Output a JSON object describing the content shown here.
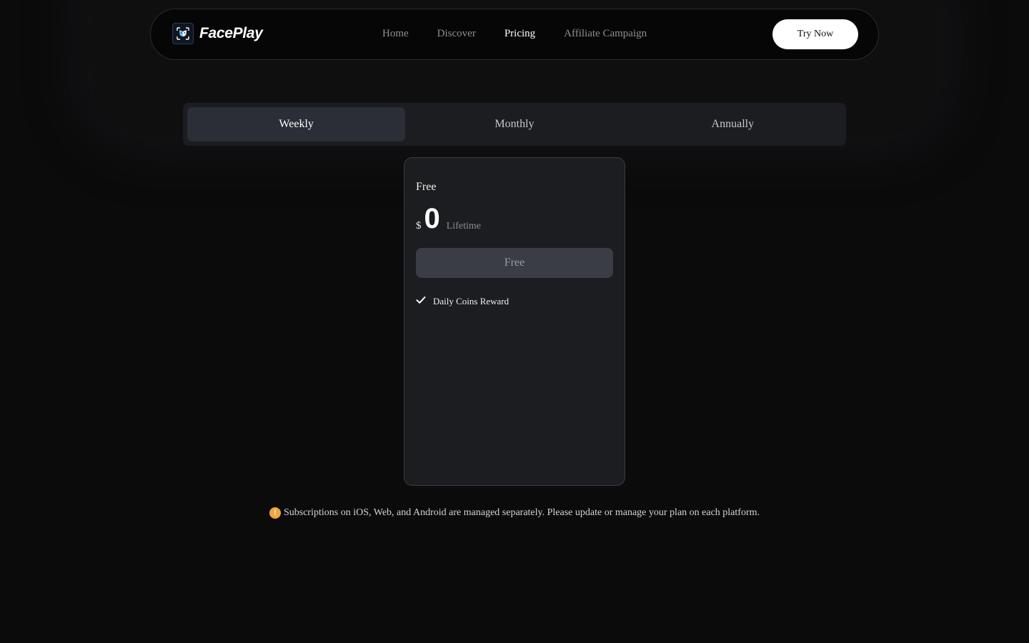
{
  "brand": {
    "name": "FacePlay",
    "logo_icon": "faceplay-logo-icon"
  },
  "nav": {
    "links": [
      "Home",
      "Discover",
      "Pricing",
      "Affiliate Campaign"
    ],
    "active": "Pricing",
    "cta_label": "Try Now"
  },
  "billing_tabs": {
    "items": [
      "Weekly",
      "Monthly",
      "Annually"
    ],
    "selected": "Weekly"
  },
  "plan": {
    "name": "Free",
    "currency": "$",
    "price": "0",
    "period": "Lifetime",
    "button_label": "Free",
    "features": [
      {
        "icon": "check-icon",
        "label": "Daily Coins Reward"
      }
    ]
  },
  "notice": {
    "icon": "warning-icon",
    "text": "Subscriptions on iOS, Web, and Android are managed separately. Please update or manage your plan on each platform."
  },
  "colors": {
    "background": "#0b0b0c",
    "card": "#1c1d20",
    "active_tab": "#2b2e36",
    "plan_button": "#3a3d45",
    "warning": "#f2a53a",
    "cta": "#ffffff"
  }
}
